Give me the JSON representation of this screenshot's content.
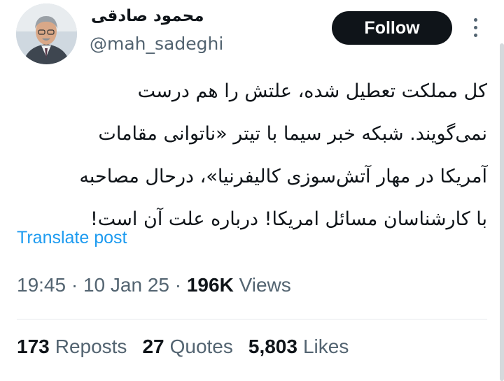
{
  "author": {
    "display_name": "محمود صادقی",
    "handle": "@mah_sadeghi"
  },
  "actions": {
    "follow_label": "Follow",
    "more_icon": "more-vertical-icon"
  },
  "post": {
    "text_lines": [
      "کل مملکت تعطیل شده، علتش را هم درست",
      "نمی‌گویند. شبکه خبر سیما با تیتر «ناتوانی مقامات",
      "آمریکا در مهار آتش‌سوزی کالیفرنیا»، درحال مصاحبه",
      "با کارشناسان مسائل امریکا! درباره علت آن است!"
    ],
    "translate_label": "Translate post",
    "time": "19:45",
    "date": "10 Jan 25",
    "separator": "·",
    "views_count": "196K",
    "views_label": "Views"
  },
  "stats": {
    "reposts_count": "173",
    "reposts_label": "Reposts",
    "quotes_count": "27",
    "quotes_label": "Quotes",
    "likes_count": "5,803",
    "likes_label": "Likes"
  },
  "colors": {
    "link": "#1d9bf0",
    "secondary_text": "#536471",
    "primary_text": "#0f1419",
    "follow_bg": "#0f1419"
  }
}
